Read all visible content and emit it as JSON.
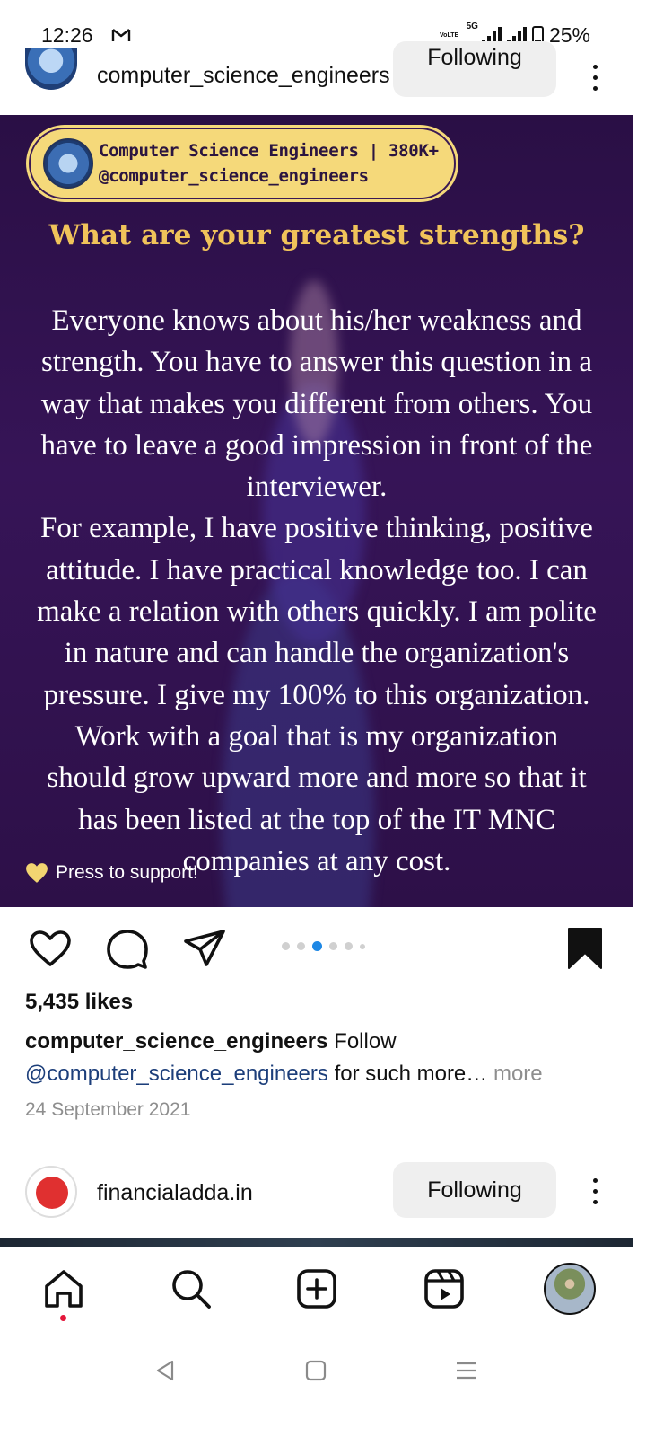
{
  "status_bar": {
    "time": "12:26",
    "network_label": "VoLTE",
    "signal_label": "5G",
    "battery": "25%"
  },
  "post": {
    "username": "computer_science_engineers",
    "follow_label": "Following",
    "image": {
      "brand_line1": "Computer Science Engineers | 380K+",
      "brand_line2": "@computer_science_engineers",
      "question": "What are your greatest strengths?",
      "body_lines": [
        "Everyone knows about his/her weakness and",
        "strength. You have to answer this question in a",
        "way that makes you different from others. You",
        "have to leave a good impression in front of the",
        "interviewer.",
        "For example, I have positive thinking, positive",
        "attitude. I have practical knowledge too. I can",
        "make a relation with others quickly. I am polite",
        "in nature and can handle the organization's",
        "pressure. I give my 100% to this organization.",
        "Work with a goal that is my organization",
        "should grow upward more and more so that it",
        "has been listed at the top of the IT MNC",
        "companies at any cost."
      ],
      "support_label": "Press to support!"
    },
    "carousel": {
      "count": 6,
      "active_index": 2
    },
    "likes": "5,435 likes",
    "caption": {
      "author": "computer_science_engineers",
      "text_before": "Follow",
      "mention": "@computer_science_engineers",
      "text_after": "for such more…",
      "more_label": "more"
    },
    "date": "24 September 2021"
  },
  "next_post": {
    "username": "financialadda.in",
    "follow_label": "Following"
  },
  "icons": {
    "like": "heart-icon",
    "comment": "comment-icon",
    "share": "send-icon",
    "save": "bookmark-icon",
    "home": "home-icon",
    "search": "search-icon",
    "create": "plus-square-icon",
    "reels": "reels-icon"
  },
  "colors": {
    "accent_blue": "#1e88e5",
    "mention": "#1c3e7a",
    "muted": "#8e8e8e",
    "headline_gold": "#f0c35a",
    "pill_yellow": "#f5d97a",
    "notification_red": "#e4163a"
  }
}
